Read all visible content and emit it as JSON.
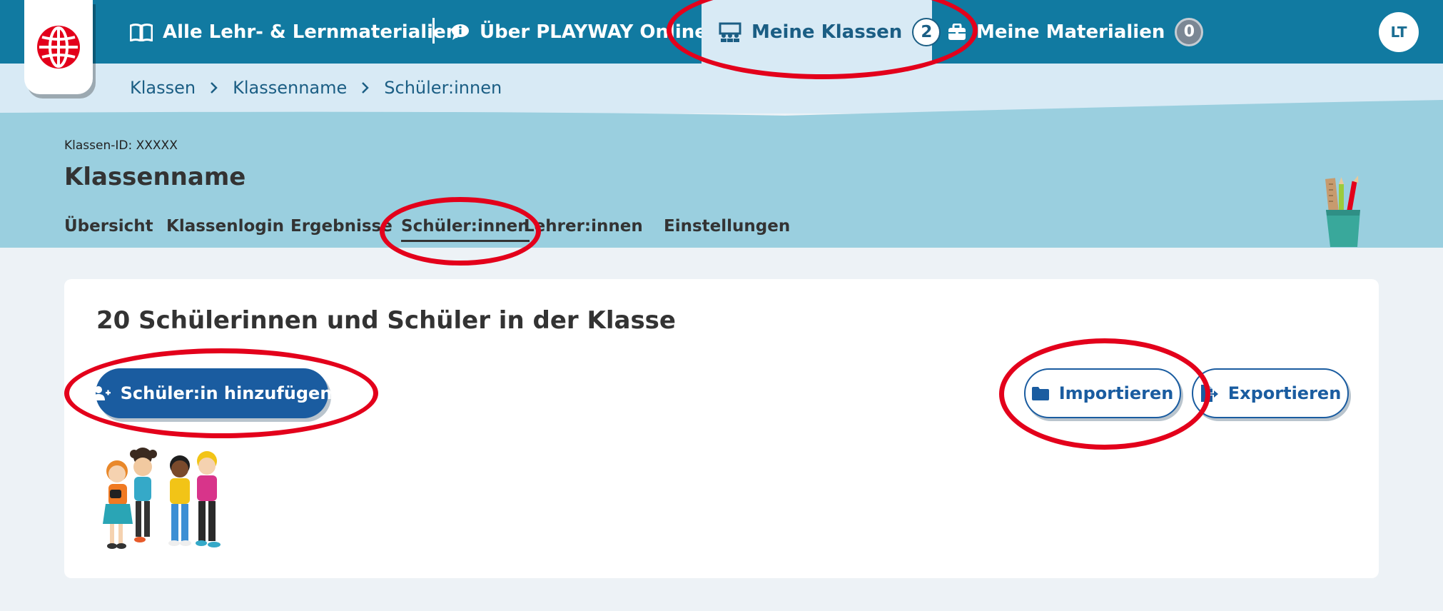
{
  "nav": {
    "items": [
      {
        "label": "Alle Lehr- & Lernmaterialien",
        "icon": "book-icon"
      },
      {
        "label": "Über PLAYWAY Online",
        "icon": "info-chat-icon"
      },
      {
        "label": "Meine Klassen",
        "icon": "classroom-icon",
        "count": "2",
        "active": true
      },
      {
        "label": "Meine Materialien",
        "icon": "briefcase-icon",
        "count": "0"
      }
    ],
    "avatar": "LT"
  },
  "breadcrumb": [
    "Klassen",
    "Klassenname",
    "Schüler:innen"
  ],
  "class": {
    "id_label": "Klassen-ID: XXXXX",
    "name": "Klassenname",
    "tabs": [
      "Übersicht",
      "Klassenlogin",
      "Ergebnisse",
      "Schüler:innen",
      "Lehrer:innen",
      "Einstellungen"
    ],
    "active_tab": "Schüler:innen"
  },
  "card": {
    "title": "20 Schülerinnen und Schüler in der Klasse",
    "add_button": "Schüler:in hinzufügen",
    "import_button": "Importieren",
    "export_button": "Exportieren"
  },
  "colors": {
    "nav_bg": "#117aa1",
    "nav_active_bg": "#d8eaf5",
    "header_bg": "#9acfdf",
    "primary_button": "#1a5ca0",
    "annotation": "#e3001b"
  }
}
